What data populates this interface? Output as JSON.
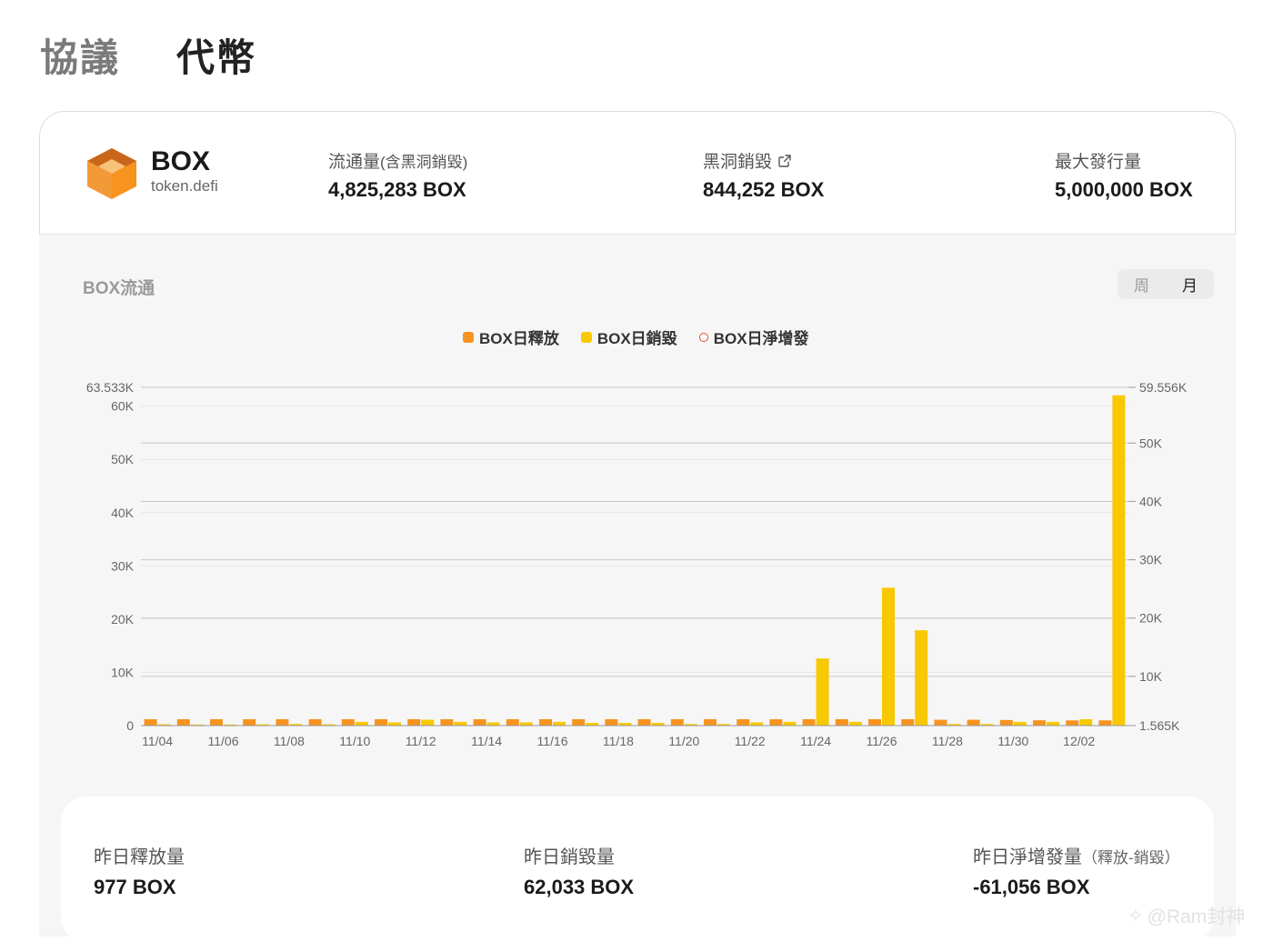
{
  "nav": {
    "tabs": [
      {
        "label": "協議"
      },
      {
        "label": "代幣"
      }
    ]
  },
  "token": {
    "name": "BOX",
    "contract": "token.defi",
    "stats": [
      {
        "label": "流通量",
        "label_note": "(含黑洞銷毀)",
        "value": "4,825,283 BOX"
      },
      {
        "label": "黑洞銷毀",
        "value": "844,252 BOX"
      },
      {
        "label": "最大發行量",
        "value": "5,000,000 BOX"
      }
    ]
  },
  "chart_panel": {
    "title": "BOX流通",
    "periods": [
      "周",
      "月"
    ],
    "active_period": "月"
  },
  "chart_data": {
    "type": "bar",
    "categories": [
      "11/04",
      "11/05",
      "11/06",
      "11/07",
      "11/08",
      "11/09",
      "11/10",
      "11/11",
      "11/12",
      "11/13",
      "11/14",
      "11/15",
      "11/16",
      "11/17",
      "11/18",
      "11/19",
      "11/20",
      "11/21",
      "11/22",
      "11/23",
      "11/24",
      "11/25",
      "11/26",
      "11/27",
      "11/28",
      "11/29",
      "11/30",
      "12/01",
      "12/02",
      "12/03"
    ],
    "x_tick_labels": [
      "11/04",
      "11/06",
      "11/08",
      "11/10",
      "11/12",
      "11/14",
      "11/16",
      "11/18",
      "11/20",
      "11/22",
      "11/24",
      "11/26",
      "11/28",
      "11/30",
      "12/02"
    ],
    "series": [
      {
        "name": "BOX日釋放",
        "color": "#f7931e",
        "values": [
          1200,
          1200,
          1200,
          1200,
          1200,
          1200,
          1200,
          1200,
          1200,
          1200,
          1200,
          1200,
          1200,
          1200,
          1200,
          1200,
          1200,
          1200,
          1200,
          1200,
          1200,
          1200,
          1200,
          1200,
          1100,
          1100,
          1050,
          1000,
          977,
          977
        ]
      },
      {
        "name": "BOX日銷毀",
        "color": "#f8c800",
        "values": [
          250,
          200,
          200,
          250,
          300,
          250,
          700,
          600,
          1100,
          700,
          600,
          600,
          700,
          500,
          500,
          500,
          300,
          300,
          600,
          700,
          12600,
          700,
          25900,
          17900,
          300,
          300,
          700,
          700,
          1200,
          62033
        ]
      },
      {
        "name": "BOX日淨增發",
        "color": "#e84a2f",
        "marker": "ring",
        "values": []
      }
    ],
    "y_left": {
      "ticks": [
        "0",
        "10K",
        "20K",
        "30K",
        "40K",
        "50K",
        "60K",
        "63.533K"
      ],
      "max_label": "63.533K",
      "range": [
        0,
        63533
      ]
    },
    "y_right": {
      "ticks": [
        "1.565K",
        "10K",
        "20K",
        "30K",
        "40K",
        "50K",
        "59.556K"
      ],
      "max_label": "59.556K",
      "range": [
        1565,
        59556
      ]
    },
    "legend_position": "top-center",
    "grid": true
  },
  "summary": [
    {
      "label": "昨日釋放量",
      "value": "977 BOX"
    },
    {
      "label": "昨日銷毀量",
      "value": "62,033 BOX"
    },
    {
      "label": "昨日淨增發量",
      "label_note": "（釋放-銷毀）",
      "value": "-61,056 BOX"
    }
  ],
  "watermark": "@Ram封神",
  "colors": {
    "brand_orange": "#f7931e",
    "burn_yellow": "#f8c800",
    "net_red": "#e84a2f"
  }
}
